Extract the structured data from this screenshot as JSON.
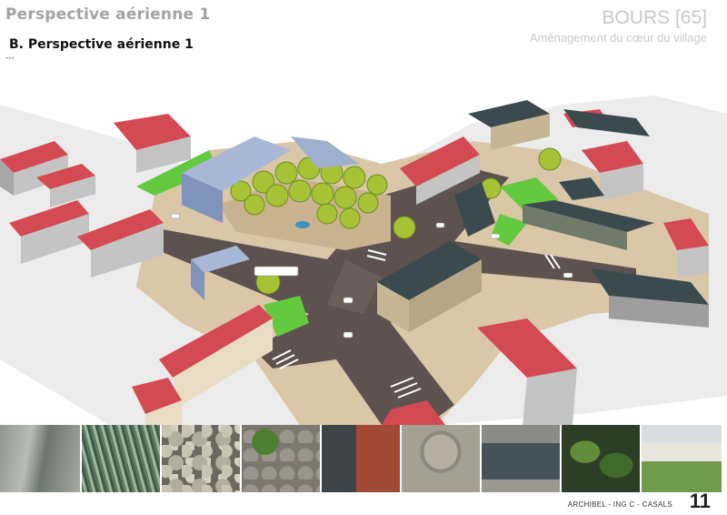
{
  "header": {
    "title": "Perspective aérienne 1"
  },
  "section": {
    "title": "B.   Perspective aérienne 1",
    "dashes": "---"
  },
  "brand": {
    "place": "BOURS [65]",
    "subtitle": "Aménagement du cœur du village"
  },
  "plan": {
    "label": "aerial-perspective-rendering"
  },
  "photos": [
    {
      "name": "photo-canal",
      "subject": "canal"
    },
    {
      "name": "photo-water-grass",
      "subject": "water-grass"
    },
    {
      "name": "photo-cobblestones",
      "subject": "cobblestones"
    },
    {
      "name": "photo-stone-wall-ivy",
      "subject": "stone-wall-ivy"
    },
    {
      "name": "photo-brick-door",
      "subject": "brick-door"
    },
    {
      "name": "photo-stone-arch",
      "subject": "stone-arch"
    },
    {
      "name": "photo-window",
      "subject": "window"
    },
    {
      "name": "photo-leaves",
      "subject": "leaves"
    },
    {
      "name": "photo-garden-house",
      "subject": "garden-house"
    }
  ],
  "footer": {
    "credit": "ARCHIBEL - ING C - CASALS",
    "page": "11"
  },
  "colors": {
    "roof_red": "#d44a52",
    "roof_slate": "#3b4a4e",
    "road": "#5e5250",
    "grass": "#63c93e",
    "tree": "#a8c236"
  }
}
